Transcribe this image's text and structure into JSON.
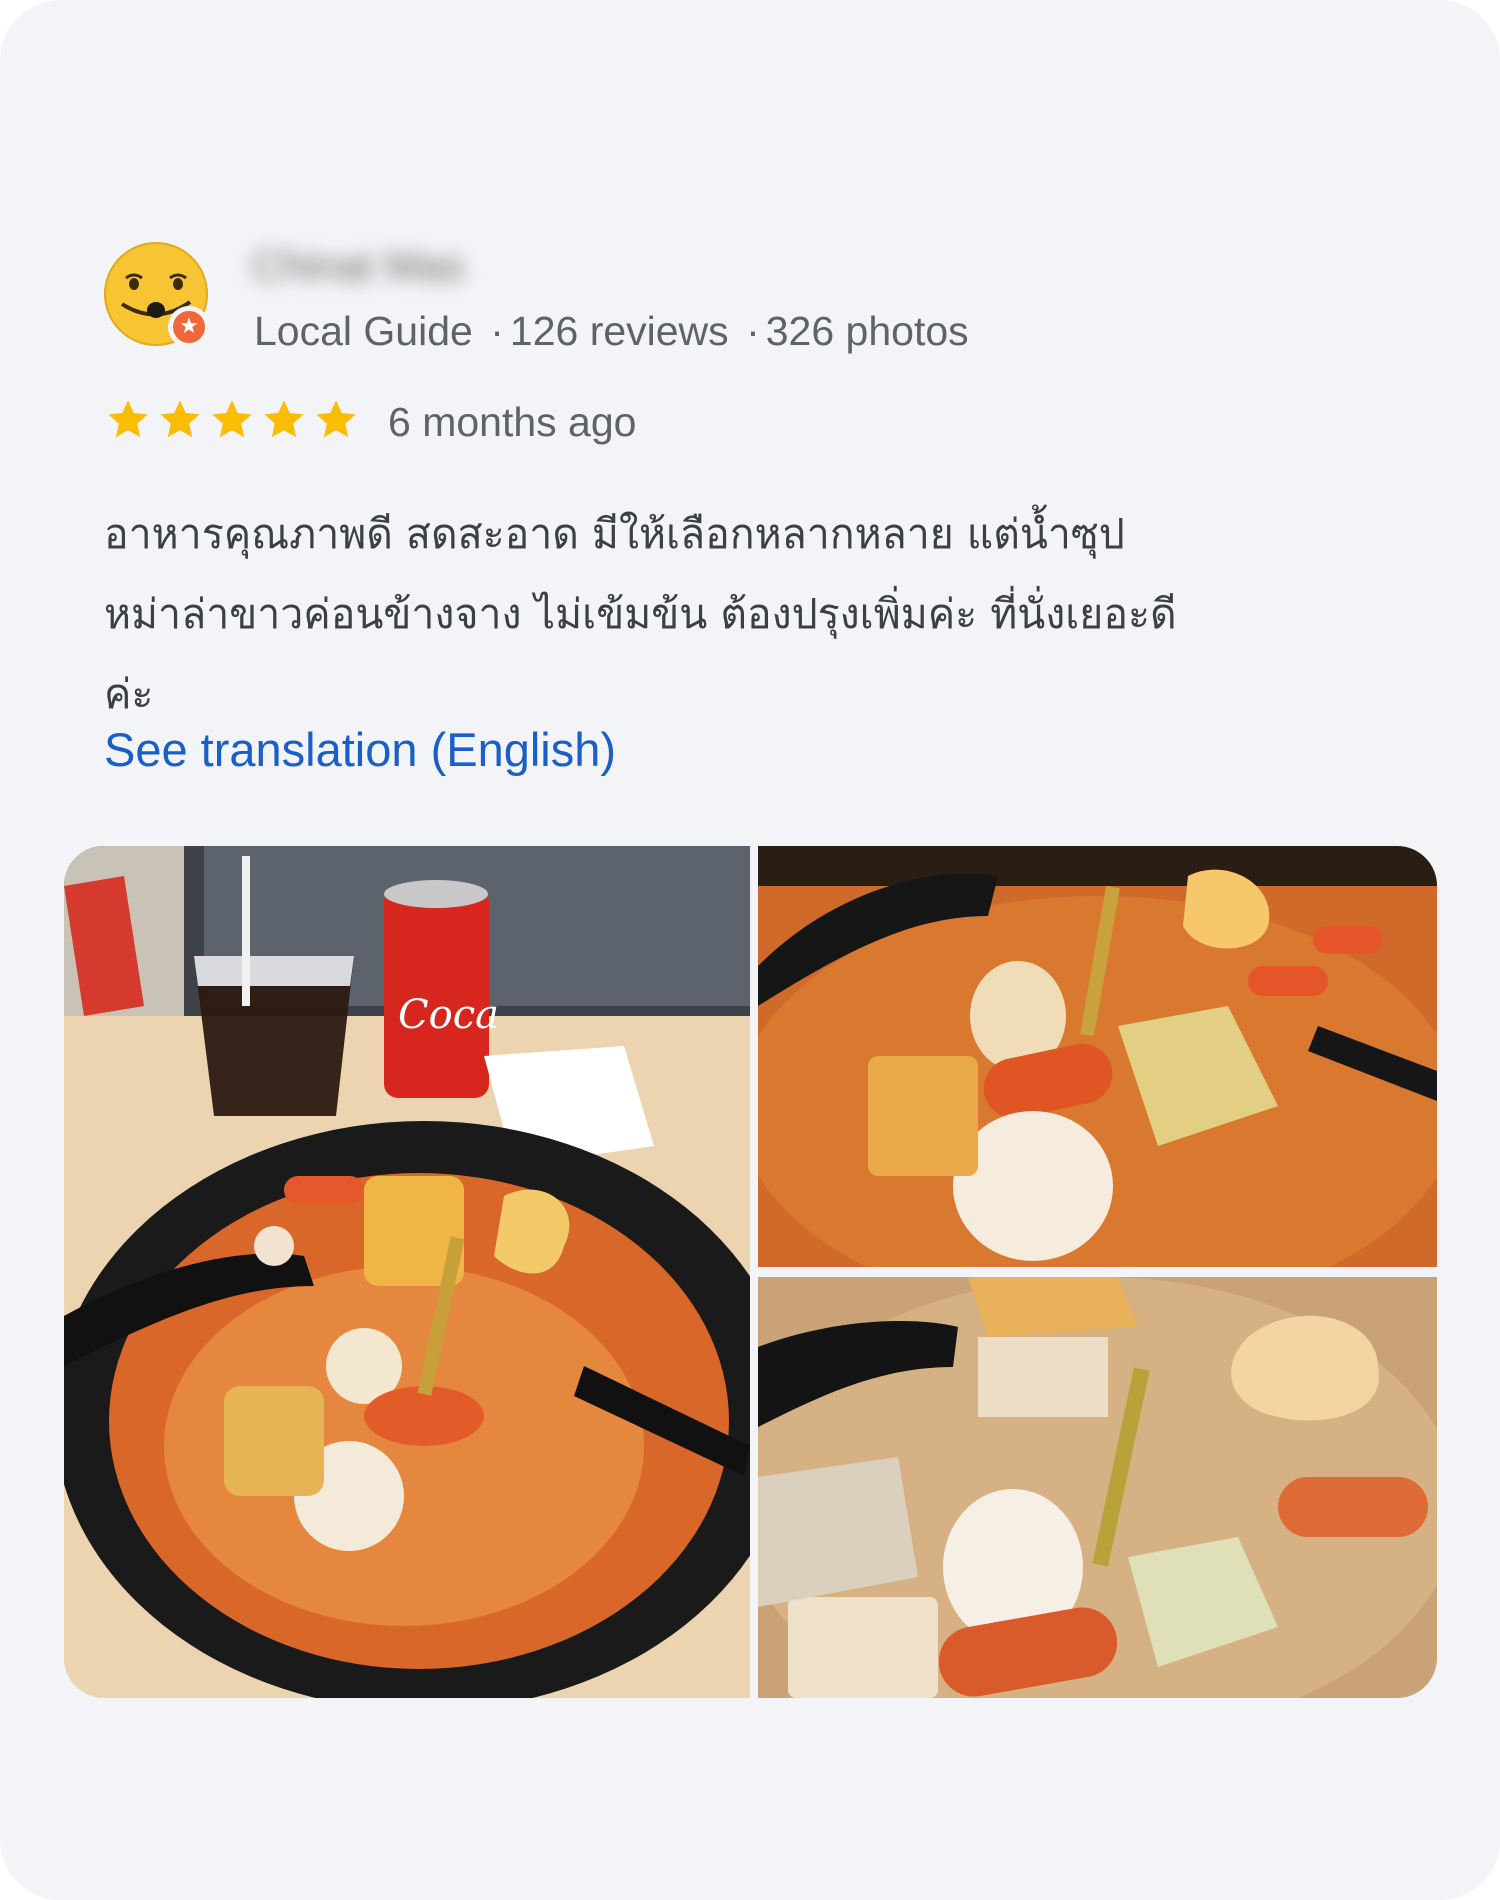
{
  "reviewer": {
    "name": "Chinat Mas",
    "avatar_icon": "smiley-face-avatar-icon",
    "badge_icon": "local-guide-star-badge-icon",
    "level": "Local Guide",
    "separator": "·",
    "review_count": "126 reviews",
    "photo_count": "326 photos"
  },
  "rating": {
    "stars": 5,
    "max": 5,
    "star_color": "#fbbc04",
    "date": "6 months ago"
  },
  "review": {
    "lines": [
      "อาหารคุณภาพดี สดสะอาด มีให้เลือกหลากหลาย แต่น้ำซุป",
      "หม่าล่าขาวค่อนข้างจาง ไม่เข้มข้น ต้องปรุงเพิ่มค่ะ ที่นั่งเยอะดี",
      "ค่ะ"
    ],
    "translation_link": "See translation (English)",
    "link_color": "#1a5fc8"
  },
  "photos": [
    {
      "name": "photo-malatang-bowl-with-drinks"
    },
    {
      "name": "photo-malatang-closeup-spicy"
    },
    {
      "name": "photo-malatang-closeup-egg"
    }
  ],
  "colors": {
    "card_background": "#f3f4f7",
    "text_secondary": "#5f6368",
    "text_primary": "#3c4043"
  }
}
